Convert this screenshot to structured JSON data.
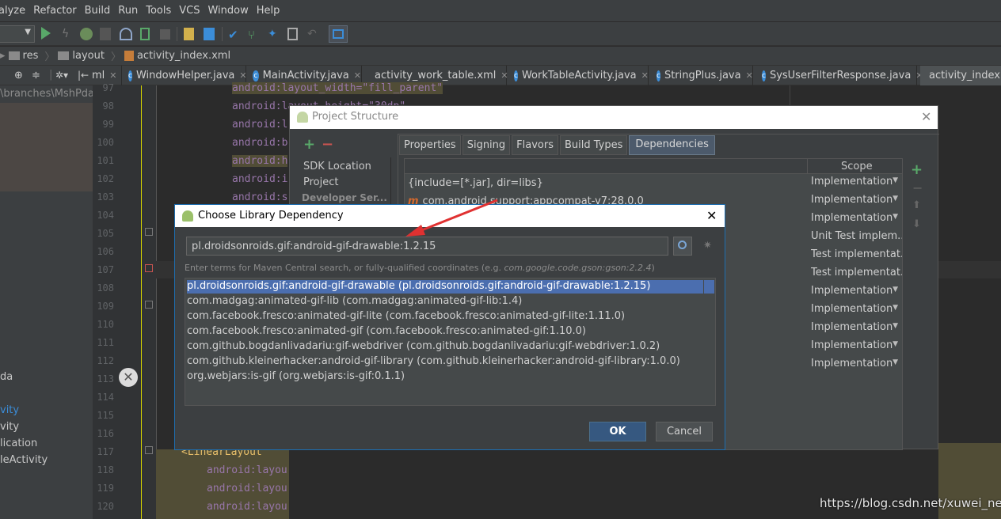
{
  "menu": {
    "items": [
      "alyze",
      "Refactor",
      "Build",
      "Run",
      "Tools",
      "VCS",
      "Window",
      "Help"
    ]
  },
  "breadcrumb": [
    "res",
    "layout",
    "activity_index.xml"
  ],
  "tabs": [
    "ml",
    "WindowHelper.java",
    "MainActivity.java",
    "activity_work_table.xml",
    "WorkTableActivity.java",
    "StringPlus.java",
    "SysUserFilterResponse.java",
    "activity_index."
  ],
  "left_panel": {
    "path": "\\branches\\MshPda",
    "items": [
      "da",
      "vity",
      "vity",
      "lication",
      "leActivity"
    ]
  },
  "gutter": {
    "lines": [
      "97",
      "98",
      "99",
      "100",
      "101",
      "102",
      "103",
      "104",
      "105",
      "106",
      "107",
      "108",
      "109",
      "110",
      "111",
      "112",
      "113",
      "114",
      "115",
      "116",
      "117",
      "118",
      "119",
      "120"
    ]
  },
  "code": {
    "l97": "android:layout_width=\"fill_parent\"",
    "l98": "android:layout_height=\"30dp\"",
    "l99": "android:l",
    "l100": "android:b",
    "l101": "android:h",
    "l102": "android:i",
    "l103": "android:s",
    "l117": "<LinearLayout",
    "l118": "android:layou",
    "l119": "android:layou",
    "l120": "android:layou"
  },
  "project_structure": {
    "title": "Project Structure",
    "add": "+",
    "remove": "−",
    "sidebar": [
      "SDK Location",
      "Project",
      "Developer Ser..."
    ],
    "tabs": [
      "Properties",
      "Signing",
      "Flavors",
      "Build Types",
      "Dependencies"
    ],
    "scope_header": "Scope",
    "rows": [
      {
        "name": "{include=[*.jar], dir=libs}",
        "scope": "Implementation"
      },
      {
        "name": "com.android.support:appcompat-v7:28.0.0",
        "scope": "Implementation"
      },
      {
        "name": "",
        "scope": "Implementation"
      },
      {
        "name": "",
        "scope": "Unit Test implem..."
      },
      {
        "name": "",
        "scope": "Test implementat..."
      },
      {
        "name": "",
        "scope": "Test implementat..."
      },
      {
        "name": "",
        "scope": "Implementation"
      },
      {
        "name": "",
        "scope": "Implementation"
      },
      {
        "name": "",
        "scope": "Implementation"
      },
      {
        "name": "",
        "scope": "Implementation"
      },
      {
        "name": "",
        "scope": "Implementation"
      }
    ]
  },
  "choose_dependency": {
    "title": "Choose Library Dependency",
    "search_value": "pl.droidsonroids.gif:android-gif-drawable:1.2.15",
    "hint_prefix": "Enter terms for Maven Central search, or fully-qualified coordinates (e.g. ",
    "hint_example": "com.google.code.gson:gson:2.2.4",
    "hint_suffix": ")",
    "results": [
      "pl.droidsonroids.gif:android-gif-drawable (pl.droidsonroids.gif:android-gif-drawable:1.2.15)",
      "com.madgag:animated-gif-lib (com.madgag:animated-gif-lib:1.4)",
      "com.facebook.fresco:animated-gif-lite (com.facebook.fresco:animated-gif-lite:1.11.0)",
      "com.facebook.fresco:animated-gif (com.facebook.fresco:animated-gif:1.10.0)",
      "com.github.bogdanlivadariu:gif-webdriver (com.github.bogdanlivadariu:gif-webdriver:1.0.2)",
      "com.github.kleinerhacker:android-gif-library (com.github.kleinerhacker:android-gif-library:1.0.0)",
      "org.webjars:is-gif (org.webjars:is-gif:0.1.1)"
    ],
    "ok": "OK",
    "cancel": "Cancel"
  },
  "watermark": "https://blog.csdn.net/xuwei_net"
}
